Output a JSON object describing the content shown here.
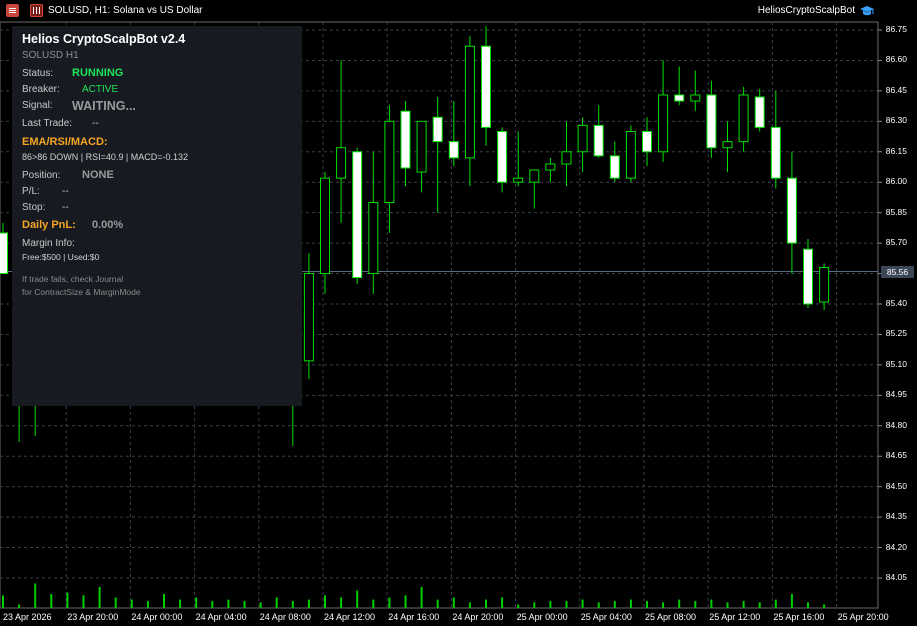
{
  "window": {
    "title": "SOLUSD, H1:  Solana vs US Dollar",
    "ea_name": "HeliosCryptoScalpBot"
  },
  "panel": {
    "title": "Helios CryptoScalpBot v2.4",
    "subtitle": "SOLUSD H1",
    "status_label": "Status:",
    "status_value": "RUNNING",
    "breaker_label": "Breaker:",
    "breaker_value": "ACTIVE",
    "signal_label": "Signal:",
    "signal_value": "WAITING...",
    "last_trade_label": "Last Trade:",
    "last_trade_value": "--",
    "indicators_heading": "EMA/RSI/MACD:",
    "indicators_value": "86>86 DOWN | RSI=40.9 | MACD=-0.132",
    "position_label": "Position:",
    "position_value": "NONE",
    "pl_label": "P/L:",
    "pl_value": "--",
    "stop_label": "Stop:",
    "stop_value": "--",
    "daily_pnl_label": "Daily PnL:",
    "daily_pnl_value": "0.00%",
    "margin_label": "Margin Info:",
    "margin_value": "Free:$500 | Used:$0",
    "note_line1": "If trade fails, check Journal",
    "note_line2": "for ContractSize & MarginMode"
  },
  "axis": {
    "y_labels": [
      "86.75",
      "86.60",
      "86.45",
      "86.30",
      "86.15",
      "86.00",
      "85.85",
      "85.70",
      "85.55",
      "85.40",
      "85.25",
      "85.10",
      "84.95",
      "84.80",
      "84.65",
      "84.50",
      "84.35",
      "84.20",
      "84.05"
    ],
    "current_price": "85.56",
    "x_labels": [
      "23 Apr 2026",
      "23 Apr 20:00",
      "24 Apr 00:00",
      "24 Apr 04:00",
      "24 Apr 08:00",
      "24 Apr 12:00",
      "24 Apr 16:00",
      "24 Apr 20:00",
      "25 Apr 00:00",
      "25 Apr 04:00",
      "25 Apr 08:00",
      "25 Apr 12:00",
      "25 Apr 16:00",
      "25 Apr 20:00"
    ]
  },
  "colors": {
    "background": "#000000",
    "grid": "#3a3f4a",
    "bull_fill": "#000000",
    "bear_fill": "#ffffff",
    "wick": "#00e000",
    "volume": "#00d000",
    "panel_bg": "#181a22",
    "accent_green": "#1ee45a",
    "accent_orange": "#f5a623"
  },
  "chart_data": {
    "type": "candlestick",
    "symbol": "SOLUSD",
    "timeframe": "H1",
    "ylim": [
      83.98,
      86.82
    ],
    "grid": true,
    "candles": [
      {
        "o": 85.75,
        "h": 85.8,
        "l": 85.55,
        "c": 85.55
      },
      {
        "o": 85.28,
        "h": 85.32,
        "l": 84.72,
        "c": 85.13
      },
      {
        "o": 85.23,
        "h": 85.25,
        "l": 84.75,
        "c": 85.13
      },
      {
        "o": 85.13,
        "h": 85.35,
        "l": 85.0,
        "c": 85.22
      },
      {
        "o": 85.22,
        "h": 85.35,
        "l": 85.05,
        "c": 85.26
      },
      {
        "o": 85.26,
        "h": 85.4,
        "l": 85.1,
        "c": 85.23
      },
      {
        "o": 85.23,
        "h": 85.3,
        "l": 85.05,
        "c": 85.2
      },
      {
        "o": 85.2,
        "h": 85.3,
        "l": 85.0,
        "c": 85.22
      },
      {
        "o": 85.22,
        "h": 85.35,
        "l": 85.15,
        "c": 85.28
      },
      {
        "o": 85.28,
        "h": 85.4,
        "l": 85.15,
        "c": 85.32
      },
      {
        "o": 85.32,
        "h": 85.45,
        "l": 85.2,
        "c": 85.36
      },
      {
        "o": 85.36,
        "h": 85.45,
        "l": 85.2,
        "c": 85.33
      },
      {
        "o": 85.33,
        "h": 85.45,
        "l": 85.2,
        "c": 85.38
      },
      {
        "o": 85.38,
        "h": 85.48,
        "l": 85.25,
        "c": 85.4
      },
      {
        "o": 85.4,
        "h": 85.48,
        "l": 85.25,
        "c": 85.37
      },
      {
        "o": 85.37,
        "h": 85.45,
        "l": 85.2,
        "c": 85.34
      },
      {
        "o": 85.34,
        "h": 85.4,
        "l": 85.1,
        "c": 85.3
      },
      {
        "o": 85.25,
        "h": 85.28,
        "l": 85.05,
        "c": 85.1
      },
      {
        "o": 85.08,
        "h": 85.12,
        "l": 84.7,
        "c": 85.18
      },
      {
        "o": 85.12,
        "h": 85.65,
        "l": 85.03,
        "c": 85.55
      },
      {
        "o": 85.55,
        "h": 86.05,
        "l": 85.45,
        "c": 86.02
      },
      {
        "o": 86.02,
        "h": 86.6,
        "l": 85.8,
        "c": 86.17
      },
      {
        "o": 86.15,
        "h": 86.17,
        "l": 85.5,
        "c": 85.53
      },
      {
        "o": 85.55,
        "h": 86.15,
        "l": 85.45,
        "c": 85.9
      },
      {
        "o": 85.9,
        "h": 86.38,
        "l": 85.75,
        "c": 86.3
      },
      {
        "o": 86.35,
        "h": 86.4,
        "l": 85.98,
        "c": 86.07
      },
      {
        "o": 86.05,
        "h": 86.3,
        "l": 85.95,
        "c": 86.3
      },
      {
        "o": 86.32,
        "h": 86.42,
        "l": 85.85,
        "c": 86.2
      },
      {
        "o": 86.2,
        "h": 86.4,
        "l": 86.08,
        "c": 86.12
      },
      {
        "o": 86.12,
        "h": 86.72,
        "l": 85.98,
        "c": 86.67
      },
      {
        "o": 86.67,
        "h": 86.77,
        "l": 86.18,
        "c": 86.27
      },
      {
        "o": 86.25,
        "h": 86.27,
        "l": 85.95,
        "c": 86.0
      },
      {
        "o": 86.0,
        "h": 86.25,
        "l": 85.98,
        "c": 86.02
      },
      {
        "o": 86.0,
        "h": 86.05,
        "l": 85.87,
        "c": 86.06
      },
      {
        "o": 86.06,
        "h": 86.12,
        "l": 86.0,
        "c": 86.09
      },
      {
        "o": 86.09,
        "h": 86.3,
        "l": 85.98,
        "c": 86.15
      },
      {
        "o": 86.15,
        "h": 86.32,
        "l": 86.05,
        "c": 86.28
      },
      {
        "o": 86.28,
        "h": 86.38,
        "l": 86.12,
        "c": 86.13
      },
      {
        "o": 86.13,
        "h": 86.2,
        "l": 86.0,
        "c": 86.02
      },
      {
        "o": 86.02,
        "h": 86.28,
        "l": 86.0,
        "c": 86.25
      },
      {
        "o": 86.25,
        "h": 86.32,
        "l": 86.08,
        "c": 86.15
      },
      {
        "o": 86.15,
        "h": 86.6,
        "l": 86.1,
        "c": 86.43
      },
      {
        "o": 86.43,
        "h": 86.57,
        "l": 86.38,
        "c": 86.4
      },
      {
        "o": 86.4,
        "h": 86.55,
        "l": 86.35,
        "c": 86.43
      },
      {
        "o": 86.43,
        "h": 86.5,
        "l": 86.12,
        "c": 86.17
      },
      {
        "o": 86.17,
        "h": 86.3,
        "l": 86.05,
        "c": 86.2
      },
      {
        "o": 86.2,
        "h": 86.47,
        "l": 86.15,
        "c": 86.43
      },
      {
        "o": 86.42,
        "h": 86.46,
        "l": 86.25,
        "c": 86.27
      },
      {
        "o": 86.27,
        "h": 86.45,
        "l": 85.97,
        "c": 86.02
      },
      {
        "o": 86.02,
        "h": 86.15,
        "l": 85.55,
        "c": 85.7
      },
      {
        "o": 85.67,
        "h": 85.72,
        "l": 85.38,
        "c": 85.4
      },
      {
        "o": 85.41,
        "h": 85.6,
        "l": 85.37,
        "c": 85.58
      }
    ],
    "volumes": [
      0.18,
      0.05,
      0.35,
      0.2,
      0.22,
      0.18,
      0.3,
      0.15,
      0.12,
      0.1,
      0.2,
      0.12,
      0.15,
      0.1,
      0.12,
      0.1,
      0.08,
      0.15,
      0.1,
      0.12,
      0.18,
      0.15,
      0.25,
      0.12,
      0.15,
      0.18,
      0.3,
      0.12,
      0.15,
      0.08,
      0.12,
      0.15,
      0.05,
      0.08,
      0.1,
      0.1,
      0.12,
      0.08,
      0.1,
      0.12,
      0.1,
      0.08,
      0.12,
      0.1,
      0.12,
      0.08,
      0.1,
      0.08,
      0.12,
      0.2,
      0.08,
      0.05
    ]
  }
}
